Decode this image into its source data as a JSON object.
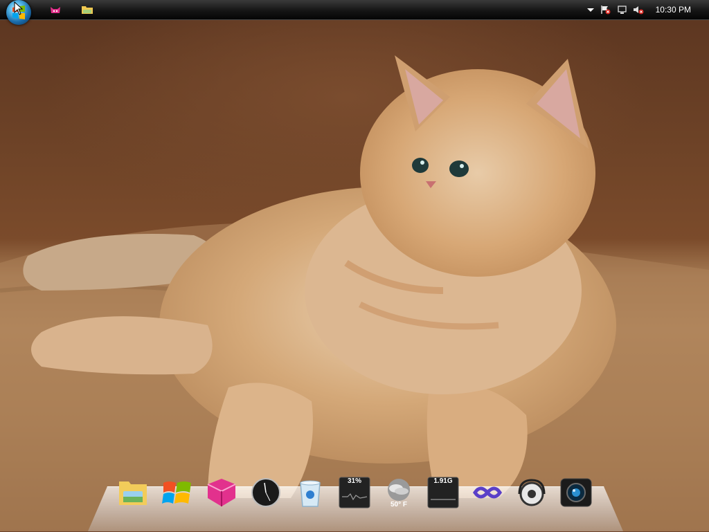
{
  "taskbar": {
    "start_button": "start-orb",
    "pinned": [
      "cat-app-icon",
      "folder-icon"
    ],
    "tray_icons": [
      "show-hidden-icons-arrow",
      "action-center-flag-icon",
      "network-icon",
      "volume-muted-icon"
    ],
    "clock": "10:30 PM"
  },
  "dock": {
    "items": [
      {
        "name": "explorer-folder-icon"
      },
      {
        "name": "windows-logo-icon"
      },
      {
        "name": "pink-cube-app-icon"
      },
      {
        "name": "clock-widget-icon"
      },
      {
        "name": "recycle-bin-icon"
      },
      {
        "name": "cpu-meter-widget",
        "value": "31%"
      },
      {
        "name": "weather-widget",
        "value": "50° F"
      },
      {
        "name": "memory-meter-widget",
        "value": "1.91G"
      },
      {
        "name": "visual-studio-icon"
      },
      {
        "name": "headphones-media-icon"
      },
      {
        "name": "camera-icon"
      }
    ]
  },
  "colors": {
    "taskbar": "#151515",
    "wallpaper_dark": "#6e4327",
    "wallpaper_light": "#b48a5f",
    "cat_fur": "#d8ad80"
  }
}
